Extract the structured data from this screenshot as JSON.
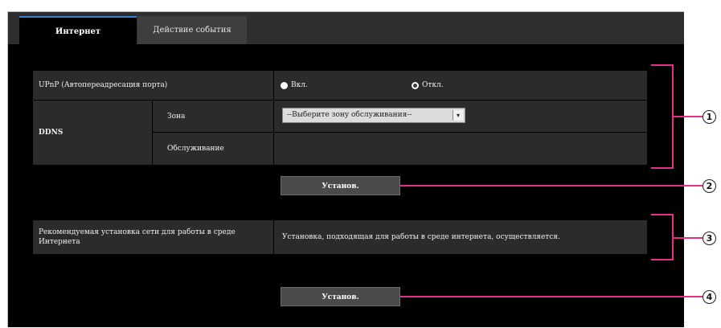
{
  "tabs": {
    "internet": "Интернет",
    "event_actions": "Действие события"
  },
  "upnp": {
    "label": "UPnP (Автопереадресация порта)",
    "option_on": "Вкл.",
    "option_off": "Откл.",
    "selected": "Откл."
  },
  "ddns": {
    "label": "DDNS",
    "zone_label": "Зона",
    "zone_value": "--Выберите зону обслуживания--",
    "service_label": "Обслуживание",
    "service_value": ""
  },
  "buttons": {
    "set1": "Установ.",
    "set2": "Установ."
  },
  "recommend": {
    "label": "Рекомендуемая установка сети для работы в среде Интернета",
    "value": "Установка, подходящая для работы в среде интернета, осуществляется."
  },
  "callouts": {
    "c1": "1",
    "c2": "2",
    "c3": "3",
    "c4": "4"
  },
  "colors": {
    "leader": "#e3318a",
    "panel": "#000000",
    "row": "#2b2b2b",
    "tab_accent": "#3b7fc4"
  }
}
